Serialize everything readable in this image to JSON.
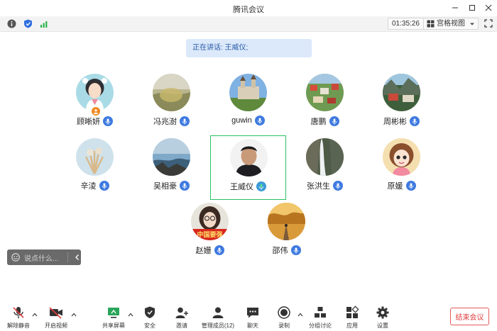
{
  "window": {
    "title": "腾讯会议"
  },
  "toolbar": {
    "timer": "01:35:26",
    "view_label": "宫格视图"
  },
  "speaking": {
    "text": "正在讲话: 王威仪;"
  },
  "participants": [
    {
      "name": "顾晰妍",
      "icon": "mic-icon",
      "host": true
    },
    {
      "name": "冯兆澍",
      "icon": "mic-icon"
    },
    {
      "name": "guwin",
      "icon": "mic-icon"
    },
    {
      "name": "唐鹏",
      "icon": "mic-icon"
    },
    {
      "name": "周彬彬",
      "icon": "mic-icon"
    },
    {
      "name": "辛淩",
      "icon": "mic-icon"
    },
    {
      "name": "吴相豪",
      "icon": "mic-icon"
    },
    {
      "name": "王威仪",
      "icon": "mic-speaking-icon",
      "active": true
    },
    {
      "name": "张洪生",
      "icon": "mic-icon"
    },
    {
      "name": "原媛",
      "icon": "mic-icon"
    },
    {
      "name": "赵姗",
      "icon": "mic-icon"
    },
    {
      "name": "邵伟",
      "icon": "mic-icon"
    }
  ],
  "avatar_overlay_text": "中国要强",
  "chat": {
    "placeholder": "说点什么..."
  },
  "bottom": {
    "unmute": "解除静音",
    "video": "开启视频",
    "share": "共享屏幕",
    "security": "安全",
    "invite": "邀请",
    "members": "管理成员(12)",
    "chat": "聊天",
    "record": "录制",
    "breakout": "分组讨论",
    "apps": "应用",
    "settings": "设置",
    "end": "结束会议"
  },
  "colors": {
    "accent": "#3f7ae0",
    "active_border": "#27c260",
    "end_red": "#e03e3e"
  }
}
